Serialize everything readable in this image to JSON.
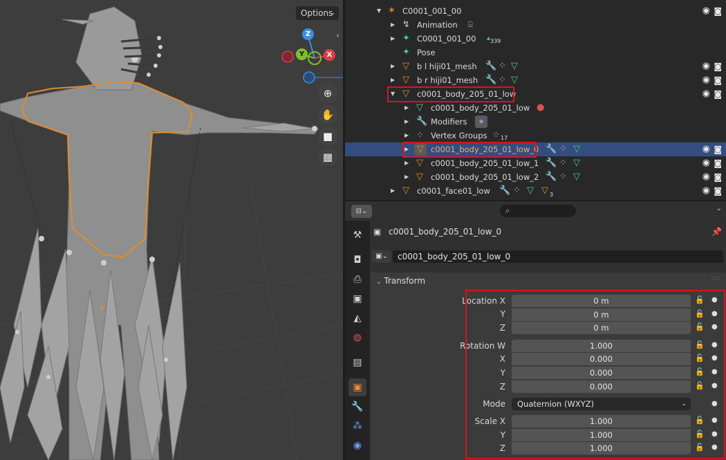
{
  "colors": {
    "accent_orange": "#e38c2f",
    "selection_blue": "#334d80",
    "annotation_red": "#d8141e",
    "axis_x": "#e23b4a",
    "axis_y": "#7fbf2a",
    "axis_z": "#3a8fe0"
  },
  "viewport": {
    "options_label": "Options",
    "axis_x": "X",
    "axis_y": "Y",
    "axis_z": "Z",
    "nav_icons": [
      "zoom-icon",
      "hand-pan-icon",
      "camera-icon",
      "grid-ortho-icon"
    ]
  },
  "outliner": {
    "rows": [
      {
        "label": "C0001_001_00",
        "icon": "armature-icon"
      },
      {
        "label": "Animation",
        "icon": "animation-icon"
      },
      {
        "label": "C0001_001_00",
        "icon": "armature-data-icon",
        "badge": "339"
      },
      {
        "label": "Pose",
        "icon": "pose-icon"
      },
      {
        "label": "b l hiji01_mesh",
        "icon": "mesh-object-icon"
      },
      {
        "label": "b r hiji01_mesh",
        "icon": "mesh-object-icon"
      },
      {
        "label": "c0001_body_205_01_low",
        "icon": "mesh-object-icon"
      },
      {
        "label": "c0001_body_205_01_low",
        "icon": "mesh-data-icon"
      },
      {
        "label": "Modifiers",
        "icon": "wrench-icon"
      },
      {
        "label": "Vertex Groups",
        "icon": "vertex-groups-icon",
        "badge": "17"
      },
      {
        "label": "c0001_body_205_01_low_0",
        "icon": "mesh-object-icon"
      },
      {
        "label": "c0001_body_205_01_low_1",
        "icon": "mesh-object-icon"
      },
      {
        "label": "c0001_body_205_01_low_2",
        "icon": "mesh-object-icon"
      },
      {
        "label": "c0001_face01_low",
        "icon": "mesh-object-icon",
        "badge": "3"
      }
    ]
  },
  "properties": {
    "object_title": "c0001_body_205_01_low_0",
    "object_name_value": "c0001_body_205_01_low_0",
    "transform_header": "Transform",
    "location": {
      "label_x": "Location X",
      "label_y": "Y",
      "label_z": "Z",
      "x": "0 m",
      "y": "0 m",
      "z": "0 m"
    },
    "rotation": {
      "label_w": "Rotation W",
      "label_x": "X",
      "label_y": "Y",
      "label_z": "Z",
      "w": "1.000",
      "x": "0.000",
      "y": "0.000",
      "z": "0.000"
    },
    "mode": {
      "label": "Mode",
      "value": "Quaternion (WXYZ)"
    },
    "scale": {
      "label_x": "Scale X",
      "label_y": "Y",
      "label_z": "Z",
      "x": "1.000",
      "y": "1.000",
      "z": "1.000"
    }
  }
}
